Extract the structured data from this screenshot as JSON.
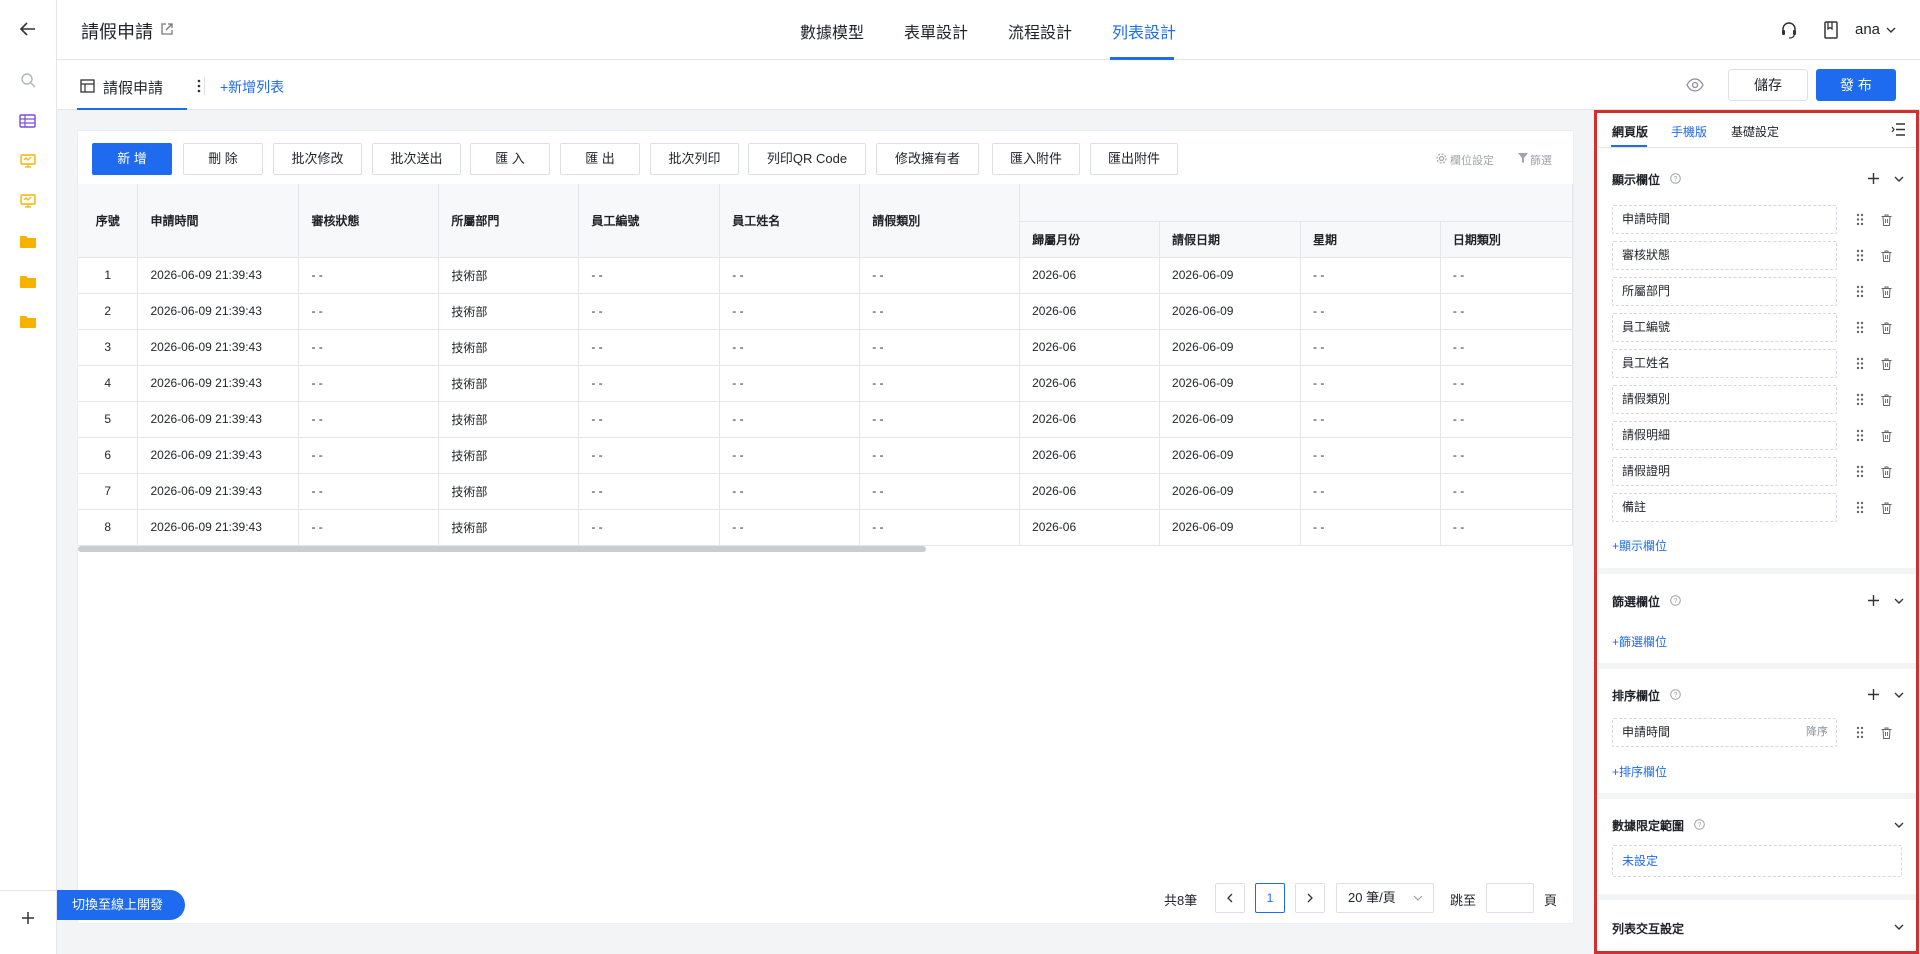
{
  "app": {
    "title": "請假申請"
  },
  "nav": {
    "tabs": [
      {
        "label": "數據模型"
      },
      {
        "label": "表單設計"
      },
      {
        "label": "流程設計"
      },
      {
        "label": "列表設計"
      }
    ],
    "active_tab": "列表設計"
  },
  "user": {
    "name": "ana"
  },
  "subheader": {
    "list_tab_label": "請假申請",
    "add_list_label": "+新增列表",
    "save_label": "儲存",
    "publish_label": "發 布"
  },
  "toolbar": {
    "buttons": [
      "新 增",
      "刪 除",
      "批次修改",
      "批次送出",
      "匯 入",
      "匯 出",
      "批次列印",
      "列印QR Code",
      "修改擁有者",
      "匯入附件",
      "匯出附件"
    ],
    "column_settings_label": "欄位設定",
    "filter_label": "篩選"
  },
  "table": {
    "columns": [
      "序號",
      "申請時間",
      "審核狀態",
      "所屬部門",
      "員工編號",
      "員工姓名",
      "請假類別",
      "歸屬月份",
      "請假日期",
      "星期",
      "日期類別"
    ],
    "rows": [
      [
        "1",
        "2026-06-09 21:39:43",
        "- -",
        "技術部",
        "- -",
        "- -",
        "- -",
        "2026-06",
        "2026-06-09",
        "- -",
        "- -"
      ],
      [
        "2",
        "2026-06-09 21:39:43",
        "- -",
        "技術部",
        "- -",
        "- -",
        "- -",
        "2026-06",
        "2026-06-09",
        "- -",
        "- -"
      ],
      [
        "3",
        "2026-06-09 21:39:43",
        "- -",
        "技術部",
        "- -",
        "- -",
        "- -",
        "2026-06",
        "2026-06-09",
        "- -",
        "- -"
      ],
      [
        "4",
        "2026-06-09 21:39:43",
        "- -",
        "技術部",
        "- -",
        "- -",
        "- -",
        "2026-06",
        "2026-06-09",
        "- -",
        "- -"
      ],
      [
        "5",
        "2026-06-09 21:39:43",
        "- -",
        "技術部",
        "- -",
        "- -",
        "- -",
        "2026-06",
        "2026-06-09",
        "- -",
        "- -"
      ],
      [
        "6",
        "2026-06-09 21:39:43",
        "- -",
        "技術部",
        "- -",
        "- -",
        "- -",
        "2026-06",
        "2026-06-09",
        "- -",
        "- -"
      ],
      [
        "7",
        "2026-06-09 21:39:43",
        "- -",
        "技術部",
        "- -",
        "- -",
        "- -",
        "2026-06",
        "2026-06-09",
        "- -",
        "- -"
      ],
      [
        "8",
        "2026-06-09 21:39:43",
        "- -",
        "技術部",
        "- -",
        "- -",
        "- -",
        "2026-06",
        "2026-06-09",
        "- -",
        "- -"
      ]
    ]
  },
  "pagination": {
    "total_label": "共8筆",
    "current_page": "1",
    "page_size_label": "20 筆/頁",
    "jump_label": "跳至",
    "page_unit": "頁"
  },
  "switch_online_label": "切換至線上開發",
  "panel": {
    "tabs": [
      "網頁版",
      "手機版",
      "基礎設定"
    ],
    "display_fields": {
      "title": "顯示欄位",
      "items": [
        "申請時間",
        "審核狀態",
        "所屬部門",
        "員工編號",
        "員工姓名",
        "請假類別",
        "請假明細",
        "請假證明",
        "備註"
      ],
      "add_label": "+顯示欄位"
    },
    "filter_fields": {
      "title": "篩選欄位",
      "add_label": "+篩選欄位"
    },
    "sort_fields": {
      "title": "排序欄位",
      "items": [
        {
          "label": "申請時間",
          "direction": "降序"
        }
      ],
      "add_label": "+排序欄位"
    },
    "data_scope": {
      "title": "數據限定範圍",
      "value": "未設定"
    },
    "list_interaction": {
      "title": "列表交互設定"
    }
  },
  "colors": {
    "primary": "#1e6bf0",
    "highlight_frame": "#d32f2f",
    "folder": "#f5b300",
    "list_icon": "#7b4fd6"
  }
}
